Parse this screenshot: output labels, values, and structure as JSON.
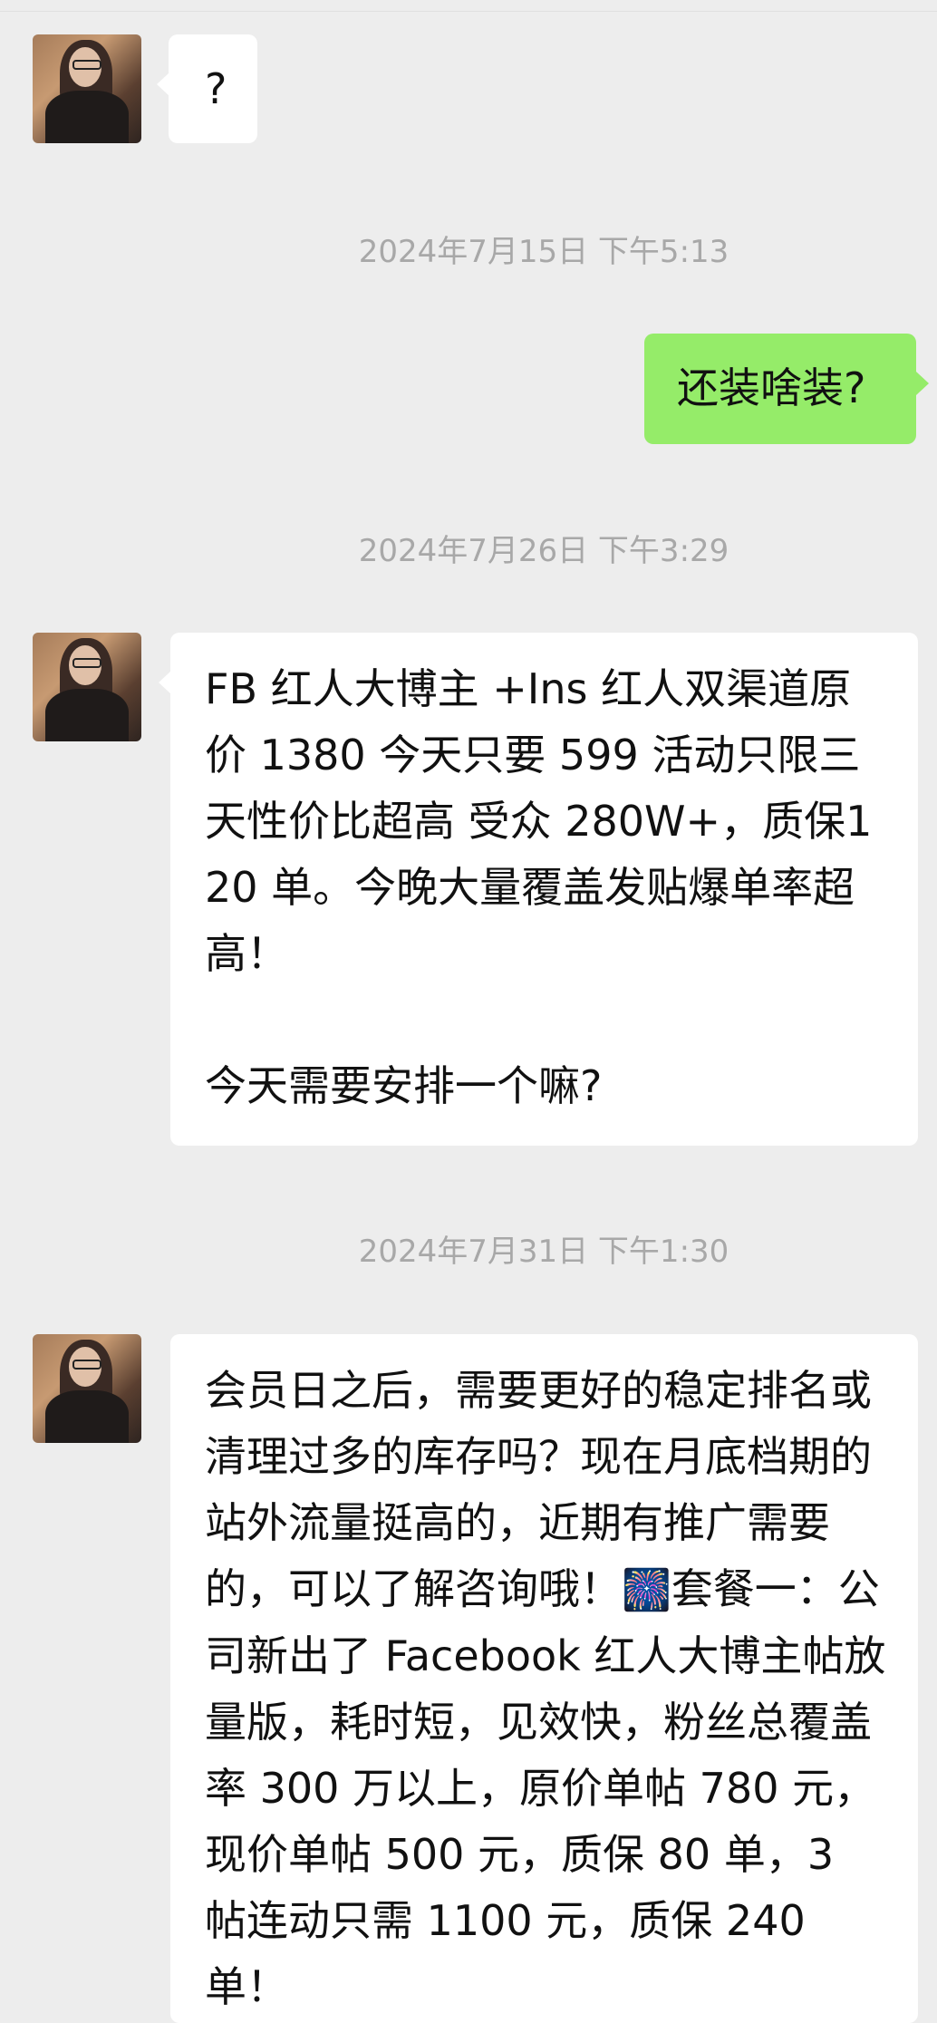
{
  "messages": [
    {
      "sender": "contact",
      "text": "?"
    },
    {
      "timestamp": "2024年7月15日 下午5:13"
    },
    {
      "sender": "me",
      "text": "还装啥装?"
    },
    {
      "timestamp": "2024年7月26日 下午3:29"
    },
    {
      "sender": "contact",
      "text": "FB 红人大博主 +Ins 红人双渠道原价 1380 今天只要 599  活动只限三天性价比超高 受众 280W+，质保120 单。今晚大量覆盖发贴爆单率超高！\n\n今天需要安排一个嘛?"
    },
    {
      "timestamp": "2024年7月31日 下午1:30"
    },
    {
      "sender": "contact",
      "text_before_emoji": "会员日之后，需要更好的稳定排名或清理过多的库存吗？现在月底档期的站外流量挺高的，近期有推广需要的，可以了解咨询哦！",
      "emoji": "🎆",
      "text_after_emoji": "套餐一：公司新出了 Facebook 红人大博主帖放量版，耗时短，见效快，粉丝总覆盖率 300 万以上，原价单帖 780 元，现价单帖 500 元，质保 80 单，3 帖连动只需 1100 元，质保 240 单！"
    }
  ]
}
